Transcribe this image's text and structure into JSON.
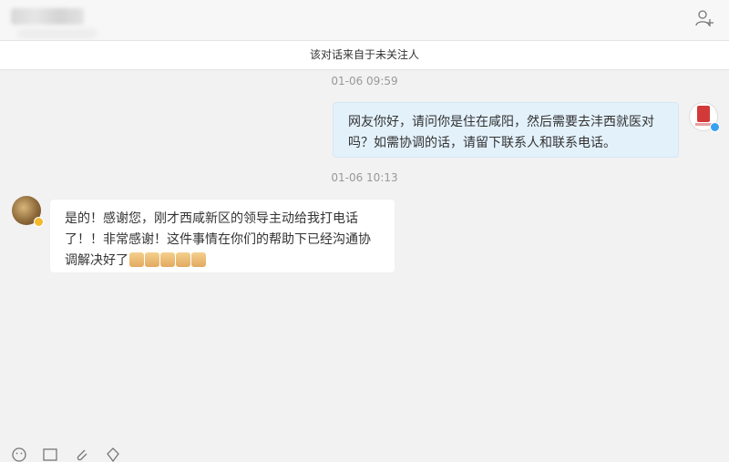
{
  "header": {
    "contact_name": "",
    "add_user_icon": "add-user-icon"
  },
  "notice": "该对话来自于未关注人",
  "messages": [
    {
      "time": "01-06 09:59",
      "sender": "me",
      "text": "网友你好，请问你是住在咸阳，然后需要去沣西就医对吗？如需协调的话，请留下联系人和联系电话。"
    },
    {
      "time": "01-06 10:13",
      "sender": "them",
      "text": "是的！感谢您，刚才西咸新区的领导主动给我打电话了！！非常感谢！这件事情在你们的帮助下已经沟通协调解决好了",
      "emoji_count": 5
    }
  ],
  "toolbar": [
    "emoji-icon",
    "image-icon",
    "attachment-icon",
    "location-icon"
  ],
  "colors": {
    "background": "#f2f2f2",
    "my_bubble": "#e3f1fb",
    "their_bubble": "#ffffff",
    "verified_blue": "#3aa0f0",
    "verified_gold": "#f3b92b"
  }
}
